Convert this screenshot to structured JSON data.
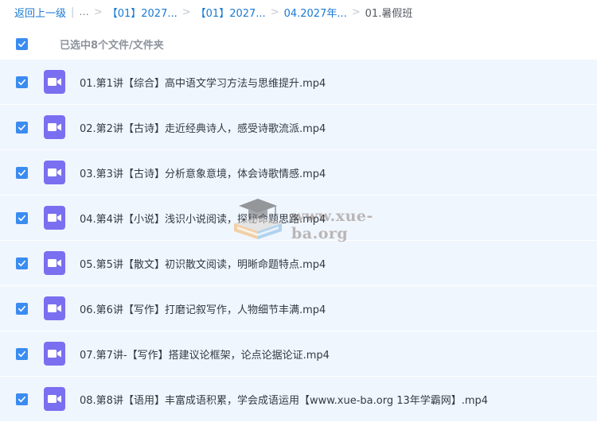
{
  "breadcrumb": {
    "back": "返回上一级",
    "ellipsis": "...",
    "items": [
      "【01】2027...",
      "【01】2027...",
      "04.2027年..."
    ],
    "current": "01.暑假班"
  },
  "selection": {
    "label": "已选中8个文件/文件夹",
    "all_checked": true
  },
  "files": [
    {
      "name": "01.第1讲【综合】高中语文学习方法与思维提升.mp4",
      "checked": true
    },
    {
      "name": "02.第2讲【古诗】走近经典诗人，感受诗歌流派.mp4",
      "checked": true
    },
    {
      "name": "03.第3讲【古诗】分析意象意境，体会诗歌情感.mp4",
      "checked": true
    },
    {
      "name": "04.第4讲【小说】浅识小说阅读，探秘命题思路.mp4",
      "checked": true
    },
    {
      "name": "05.第5讲【散文】初识散文阅读，明晰命题特点.mp4",
      "checked": true
    },
    {
      "name": "06.第6讲【写作】打磨记叙写作，人物细节丰满.mp4",
      "checked": true
    },
    {
      "name": "07.第7讲-【写作】搭建议论框架，论点论据论证.mp4",
      "checked": true
    },
    {
      "name": "08.第8讲【语用】丰富成语积累，学会成语运用【www.xue-ba.org 13年学霸网】.mp4",
      "checked": true
    }
  ],
  "watermark": {
    "text": "www.xue-ba.org"
  },
  "colors": {
    "link": "#1a7ad4",
    "checkbox": "#3b8cf0",
    "video_icon": "#7a6ff0",
    "row_bg": "#f0f6fe"
  },
  "icons": {
    "checkbox": "check-icon",
    "file": "video-file-icon",
    "watermark_logo": "graduation-cap-book-icon"
  }
}
